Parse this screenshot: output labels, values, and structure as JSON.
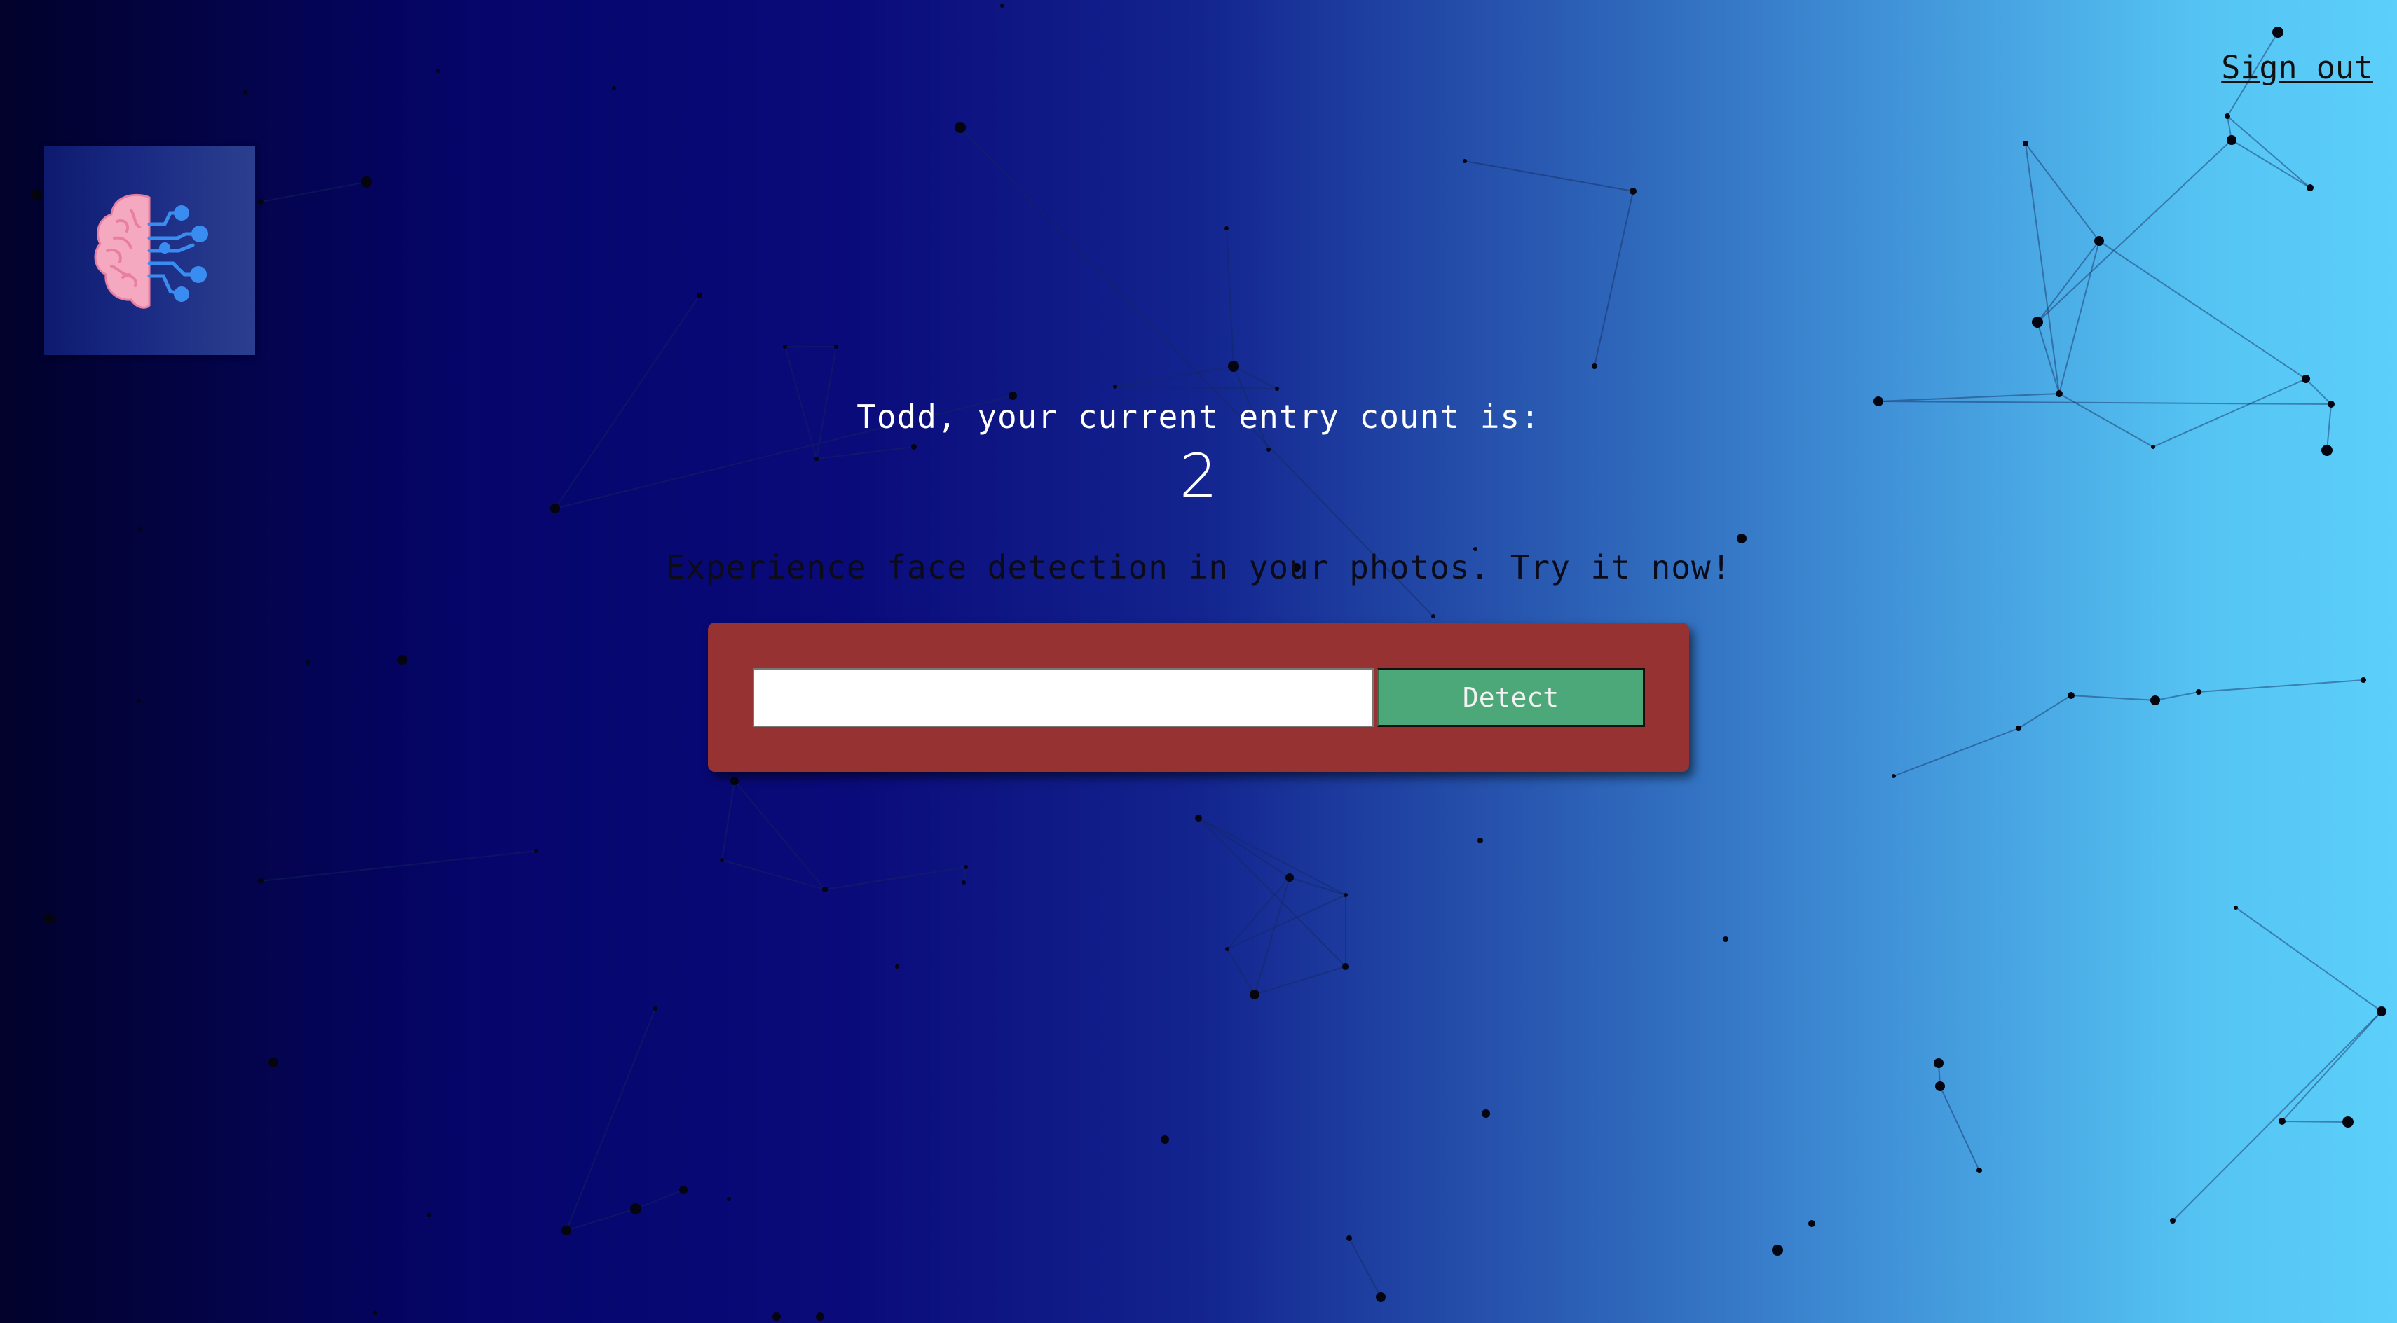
{
  "nav": {
    "signout_label": "Sign out"
  },
  "logo": {
    "icon": "brain-circuit-icon"
  },
  "rank": {
    "message": "Todd, your current entry count is:",
    "count": "2"
  },
  "tagline": "Experience face detection in your photos. Try it now!",
  "form": {
    "input_value": "",
    "input_placeholder": "",
    "button_label": "Detect"
  },
  "colors": {
    "form_bg": "#963232",
    "button_bg": "#4ca878",
    "brain_pink": "#f2a0b8",
    "circuit_blue": "#3a8df0"
  }
}
